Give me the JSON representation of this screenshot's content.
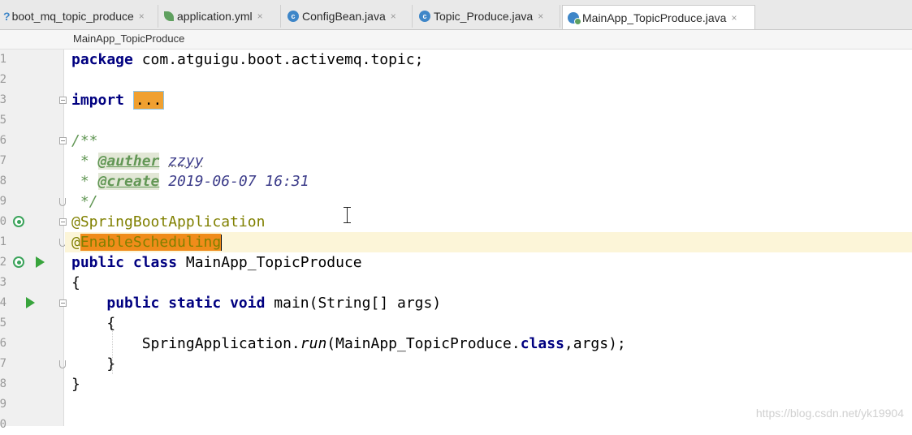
{
  "tabs": [
    {
      "label": "boot_mq_topic_produce",
      "icon": "module-icon",
      "prefix": "?"
    },
    {
      "label": "application.yml",
      "icon": "yaml-leaf-icon"
    },
    {
      "label": "ConfigBean.java",
      "icon": "class-icon"
    },
    {
      "label": "Topic_Produce.java",
      "icon": "class-icon"
    },
    {
      "label": "MainApp_TopicProduce.java",
      "icon": "spring-app-class-icon",
      "active": true
    }
  ],
  "tab_close_glyph": "×",
  "breadcrumb": "MainApp_TopicProduce",
  "line_numbers": [
    "1",
    "2",
    "3",
    "5",
    "6",
    "7",
    "8",
    "9",
    "0",
    "1",
    "2",
    "3",
    "4",
    "5",
    "6",
    "7",
    "8",
    "9",
    "0"
  ],
  "code": {
    "package_kw": "package",
    "package_name": " com.atguigu.boot.activemq.topic;",
    "import_kw": "import",
    "import_fold": "...",
    "doc_open": "/**",
    "doc_star": " * ",
    "auther_tag": "@auther",
    "auther_val": "zzyy",
    "create_tag": "@create",
    "create_val": " 2019-06-07 16:31",
    "doc_close": " */",
    "ann1": "@SpringBootApplication",
    "ann2_at": "@",
    "ann2_name": "EnableScheduling",
    "class_kw": "public class",
    "class_name": " MainApp_TopicProduce",
    "brace_open": "{",
    "method_kw": "public static void",
    "method_sig": " main(String[] args)",
    "run_prefix": "SpringApplication.",
    "run_method": "run",
    "run_args_a": "(MainApp_TopicProduce.",
    "run_class_kw": "class",
    "run_args_b": ",args);",
    "brace_close": "}"
  },
  "watermark": "https://blog.csdn.net/yk19904",
  "colors": {
    "keyword": "#000080",
    "annotation": "#808000",
    "doc": "#629755",
    "current_line": "#fcf5d8",
    "highlight": "#f08c1a"
  }
}
